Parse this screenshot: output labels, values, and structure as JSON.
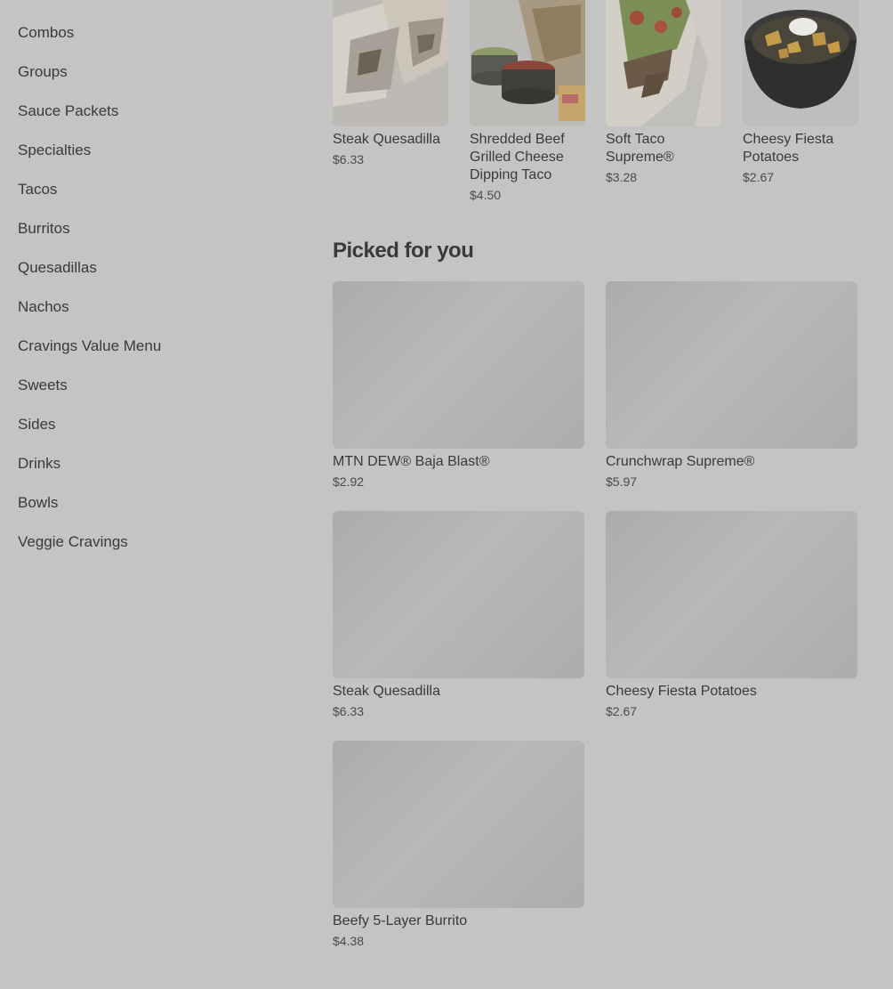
{
  "sidebar": {
    "items": [
      {
        "label": "Combos"
      },
      {
        "label": "Groups"
      },
      {
        "label": "Sauce Packets"
      },
      {
        "label": "Specialties"
      },
      {
        "label": "Tacos"
      },
      {
        "label": "Burritos"
      },
      {
        "label": "Quesadillas"
      },
      {
        "label": "Nachos"
      },
      {
        "label": "Cravings Value Menu"
      },
      {
        "label": "Sweets"
      },
      {
        "label": "Sides"
      },
      {
        "label": "Drinks"
      },
      {
        "label": "Bowls"
      },
      {
        "label": "Veggie Cravings"
      }
    ]
  },
  "top_items": [
    {
      "name": "Steak Quesadilla",
      "price": "$6.33"
    },
    {
      "name": "Shredded Beef Grilled Cheese Dipping Taco",
      "price": "$4.50"
    },
    {
      "name": "Soft Taco Supreme®",
      "price": "$3.28"
    },
    {
      "name": "Cheesy Fiesta Potatoes",
      "price": "$2.67"
    }
  ],
  "picked": {
    "title": "Picked for you",
    "items": [
      {
        "name": "MTN DEW® Baja Blast®",
        "price": "$2.92"
      },
      {
        "name": "Crunchwrap Supreme®",
        "price": "$5.97"
      },
      {
        "name": "Steak Quesadilla",
        "price": "$6.33"
      },
      {
        "name": "Cheesy Fiesta Potatoes",
        "price": "$2.67"
      },
      {
        "name": "Beefy 5-Layer Burrito",
        "price": "$4.38"
      }
    ]
  },
  "colors": {
    "page_background": "#c4c4c4",
    "placeholder": "#b2b2b2",
    "text": "#3a3a3a"
  }
}
